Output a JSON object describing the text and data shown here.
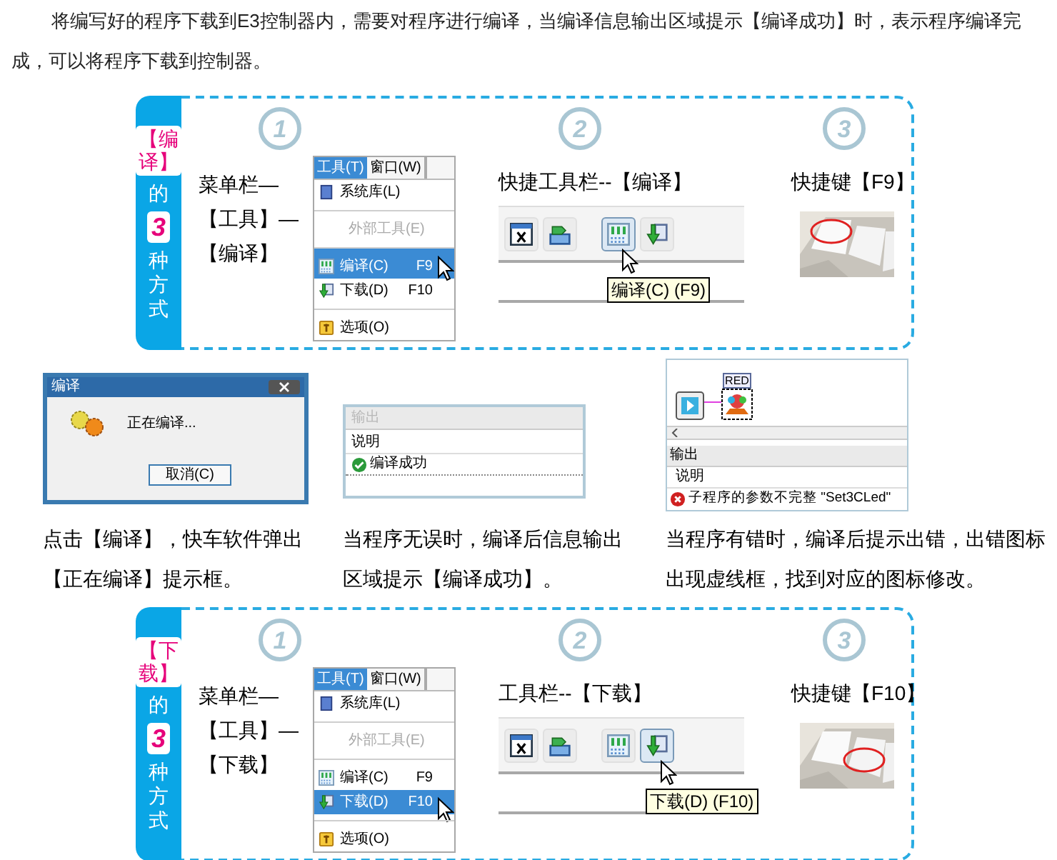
{
  "intro": "将编写好的程序下载到E3控制器内，需要对程序进行编译，当编译信息输出区域提示【编译成功】时，表示程序编译完成，可以将程序下载到控制器。",
  "panels": [
    {
      "side": {
        "bracket_word": "【编译】",
        "of": "的",
        "count": "3",
        "tail": "种方式"
      },
      "menu_step": {
        "number": "1",
        "caption_lines": [
          "菜单栏—",
          "【工具】—",
          "【编译】"
        ],
        "menu": {
          "tabs": [
            {
              "label": "工具(T)",
              "selected": true
            },
            {
              "label": "窗口(W)",
              "selected": false
            }
          ],
          "items": [
            {
              "kind": "library",
              "label": "系统库(L)",
              "disabled": false,
              "selected": false,
              "divider_above": false
            },
            {
              "kind": "tools",
              "label": "外部工具(E)",
              "disabled": true,
              "selected": false,
              "divider_above": true
            },
            {
              "kind": "compile",
              "label": "编译(C)",
              "shortcut": "F9",
              "disabled": false,
              "selected": true,
              "divider_above": true
            },
            {
              "kind": "download",
              "label": "下载(D)",
              "shortcut": "F10",
              "disabled": false,
              "selected": false,
              "divider_above": false
            },
            {
              "kind": "options",
              "label": "选项(O)",
              "disabled": false,
              "selected": false,
              "divider_above": true
            }
          ]
        }
      },
      "toolbar_step": {
        "number": "2",
        "caption": "快捷工具栏--【编译】",
        "buttons": [
          {
            "kind": "variable",
            "selected": false
          },
          {
            "kind": "transfer",
            "selected": false
          },
          {
            "kind": "compile",
            "selected": true
          },
          {
            "kind": "download",
            "selected": false
          }
        ],
        "tooltip": "编译(C) (F9)"
      },
      "key_step": {
        "number": "3",
        "caption": "快捷键【F9】"
      }
    },
    {
      "side": {
        "bracket_word": "【下载】",
        "of": "的",
        "count": "3",
        "tail": "种方式"
      },
      "menu_step": {
        "number": "1",
        "caption_lines": [
          "菜单栏—",
          "【工具】—",
          "【下载】"
        ],
        "menu": {
          "tabs": [
            {
              "label": "工具(T)",
              "selected": true
            },
            {
              "label": "窗口(W)",
              "selected": false
            }
          ],
          "items": [
            {
              "kind": "library",
              "label": "系统库(L)",
              "disabled": false,
              "selected": false,
              "divider_above": false
            },
            {
              "kind": "tools",
              "label": "外部工具(E)",
              "disabled": true,
              "selected": false,
              "divider_above": true
            },
            {
              "kind": "compile",
              "label": "编译(C)",
              "shortcut": "F9",
              "disabled": false,
              "selected": false,
              "divider_above": true
            },
            {
              "kind": "download",
              "label": "下载(D)",
              "shortcut": "F10",
              "disabled": false,
              "selected": true,
              "divider_above": false
            },
            {
              "kind": "options",
              "label": "选项(O)",
              "disabled": false,
              "selected": false,
              "divider_above": true
            }
          ]
        }
      },
      "toolbar_step": {
        "number": "2",
        "caption": "工具栏--【下载】",
        "buttons": [
          {
            "kind": "variable",
            "selected": false
          },
          {
            "kind": "transfer",
            "selected": false
          },
          {
            "kind": "compile",
            "selected": false
          },
          {
            "kind": "download",
            "selected": true
          }
        ],
        "tooltip": "下载(D) (F10)"
      },
      "key_step": {
        "number": "3",
        "caption": "快捷键【F10】"
      }
    }
  ],
  "examples": [
    {
      "kind": "dialog",
      "screen": {
        "title": "编译",
        "message": "正在编译...",
        "button": "取消(C)"
      },
      "caption": "点击【编译】，快车软件弹出【正在编译】提示框。"
    },
    {
      "kind": "output",
      "screen": {
        "title": "输出",
        "column": "说明",
        "message": "编译成功"
      },
      "caption": "当程序无误时，编译后信息输出区域提示【编译成功】。"
    },
    {
      "kind": "error",
      "screen": {
        "block_label": "RED",
        "title": "输出",
        "column": "说明",
        "message": "子程序的参数不完整 \"Set3CLed\""
      },
      "caption": "当程序有错时，编译后提示出错，出错图标出现虚线框，找到对应的图标修改。"
    }
  ]
}
